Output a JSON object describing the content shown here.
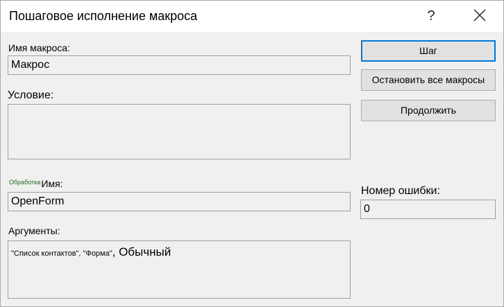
{
  "window": {
    "title": "Пошаговое исполнение макроса",
    "help_label": "?"
  },
  "macro_name": {
    "label": "Имя макроса:",
    "value": "Макрос"
  },
  "condition": {
    "label": "Условие:",
    "value": ""
  },
  "action_name": {
    "tag": "Обработка",
    "label": "Имя:",
    "value": "OpenForm"
  },
  "arguments": {
    "label": "Аргументы:",
    "value_part1": "\"Список контактов\", \"Форма\"",
    "value_part2": ", Обычный"
  },
  "error_number": {
    "label": "Номер ошибки:",
    "value": "0"
  },
  "buttons": {
    "step": "Шаг",
    "stop_all": "Остановить все макросы",
    "continue": "Продолжить"
  },
  "icons": {
    "close": "close-icon",
    "help": "help-icon"
  },
  "colors": {
    "default_button_border": "#0078d7",
    "window_background": "#f0f0f0",
    "titlebar_background": "#ffffff"
  }
}
